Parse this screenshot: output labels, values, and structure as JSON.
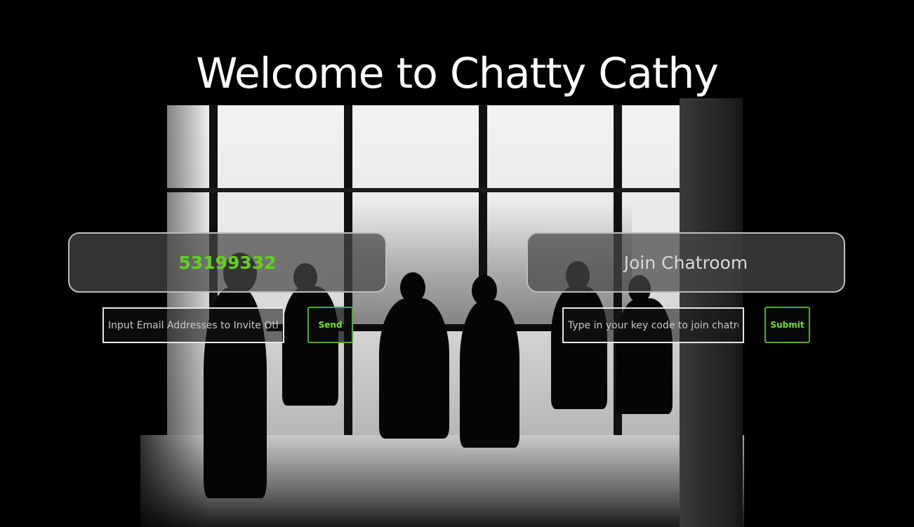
{
  "page": {
    "title": "Welcome to Chatty Cathy"
  },
  "room": {
    "key_code": "53199332",
    "join_label": "Join Chatroom"
  },
  "invite": {
    "email_placeholder": "Input Email Addresses to Invite Others",
    "send_label": "Send"
  },
  "join": {
    "key_placeholder": "Type in your key code to join chatroom",
    "submit_label": "Submit"
  },
  "colors": {
    "accent_green": "#5fd31b",
    "button_border": "#4caf1e",
    "panel_border": "#bdbdbd"
  }
}
